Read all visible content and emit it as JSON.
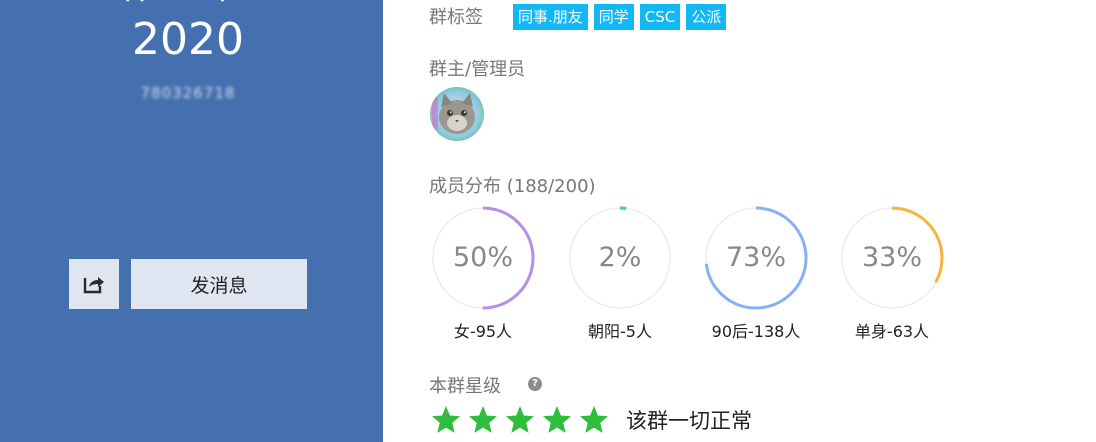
{
  "group": {
    "year": "2020",
    "qq_number": "780326718"
  },
  "actions": {
    "send_message_label": "发消息"
  },
  "tags_section": {
    "label": "群标签",
    "tags": [
      "同事.朋友",
      "同学",
      "CSC",
      "公派"
    ]
  },
  "admin_section": {
    "label": "群主/管理员"
  },
  "members_section": {
    "label": "成员分布 (188/200)",
    "stats": [
      {
        "percent": "50%",
        "fraction": 0.5,
        "caption": "女-95人",
        "color": "#b58ee8"
      },
      {
        "percent": "2%",
        "fraction": 0.02,
        "caption": "朝阳-5人",
        "color": "#3fcf9a"
      },
      {
        "percent": "73%",
        "fraction": 0.73,
        "caption": "90后-138人",
        "color": "#86b2ef"
      },
      {
        "percent": "33%",
        "fraction": 0.33,
        "caption": "单身-63人",
        "color": "#f6b33f"
      }
    ]
  },
  "rating_section": {
    "label": "本群星级",
    "help_icon": "?",
    "stars": 5,
    "status": "该群一切正常",
    "star_color": "#2ebd3c"
  },
  "icons": {
    "share": "share-icon",
    "help": "help-icon",
    "star": "star-icon"
  }
}
